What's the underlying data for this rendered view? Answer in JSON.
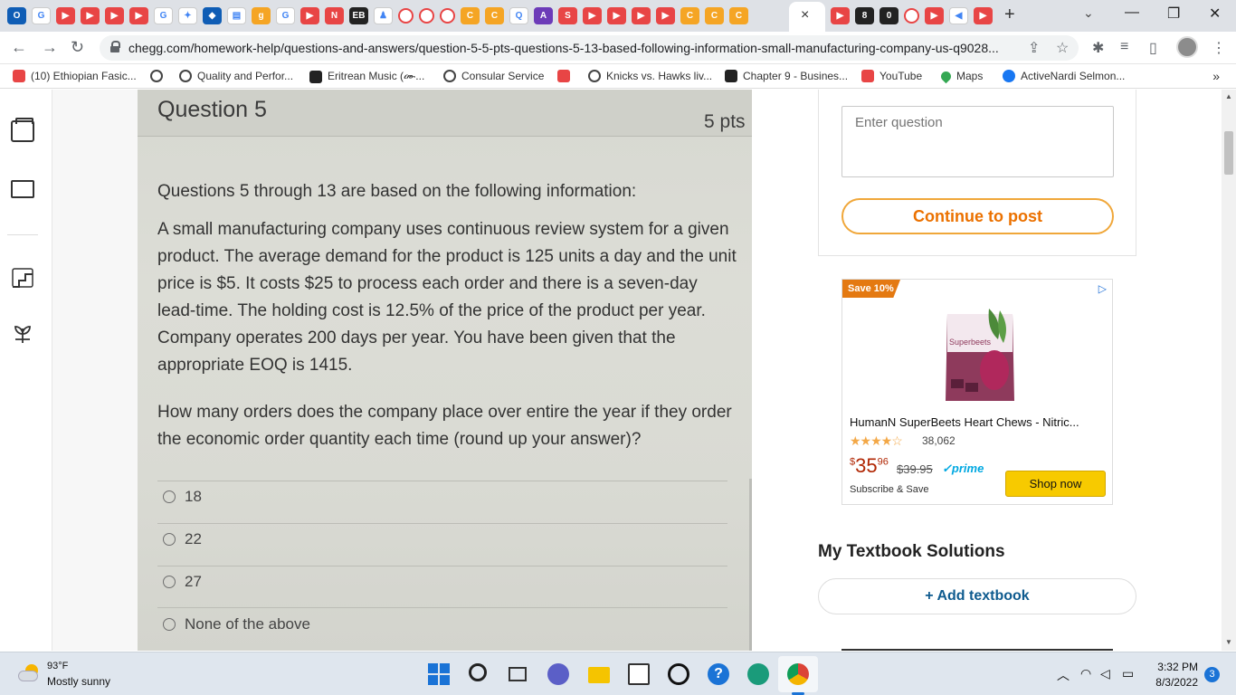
{
  "browser": {
    "url": "chegg.com/homework-help/questions-and-answers/question-5-5-pts-questions-5-13-based-following-information-small-manufacturing-company-us-q9028...",
    "active_tab_close": "×",
    "new_tab": "+",
    "bookmarks": [
      {
        "label": "(10) Ethiopian Fasic...",
        "icon": "youtube-icon"
      },
      {
        "label": "",
        "icon": "globe-icon"
      },
      {
        "label": "Quality and Perfor...",
        "icon": "globe-icon"
      },
      {
        "label": "Eritrean Music (ሙ...",
        "icon": "music-icon"
      },
      {
        "label": "Consular Service",
        "icon": "globe-icon"
      },
      {
        "label": "",
        "icon": "youtube-icon"
      },
      {
        "label": "Knicks vs. Hawks liv...",
        "icon": "globe-icon"
      },
      {
        "label": "Chapter 9 - Busines...",
        "icon": "grid-icon"
      },
      {
        "label": "YouTube",
        "icon": "youtube-icon"
      },
      {
        "label": "Maps",
        "icon": "maps-icon"
      },
      {
        "label": "ActiveNardi Selmon...",
        "icon": "facebook-icon"
      }
    ],
    "bookmarks_more": "»"
  },
  "question": {
    "title": "Question 5",
    "points": "5 pts",
    "intro": "Questions 5 through 13 are based on the following information:",
    "body": "A small manufacturing company uses continuous review system for a given product. The average demand for the product is 125 units a day and the unit price is $5. It costs $25 to process each order and there is a seven-day lead-time. The holding cost is 12.5% of the price of the product per year. Company operates 200 days per year. You have been given that the appropriate EOQ is 1415.",
    "ask": "How many orders does the company place over entire the year if they order the economic order quantity each time (round up your answer)?",
    "options": [
      "18",
      "22",
      "27",
      "None of the above"
    ]
  },
  "sidebar": {
    "question_placeholder": "Enter question",
    "continue_label": "Continue to post",
    "textbook_heading": "My Textbook Solutions",
    "add_textbook_label": "+ Add textbook"
  },
  "ad": {
    "badge": "Save 10%",
    "product_brand": "Superbeets",
    "title": "HumanN SuperBeets Heart Chews - Nitric...",
    "stars": "★★★★☆",
    "rating_count": "38,062",
    "price_dollars": "35",
    "price_cents": "96",
    "list_price": "$39.95",
    "prime": "✓prime",
    "subscribe": "Subscribe & Save",
    "shop_label": "Shop now"
  },
  "taskbar": {
    "temperature": "93°F",
    "weather": "Mostly sunny",
    "time": "3:32 PM",
    "date": "8/3/2022",
    "notifications": "3",
    "help_glyph": "?"
  },
  "colors": {
    "accent_orange": "#eb7100",
    "continue_border": "#f0a73a",
    "add_textbook_blue": "#0f5b8f",
    "price_red": "#b12704",
    "shop_yellow": "#f7ca00"
  }
}
